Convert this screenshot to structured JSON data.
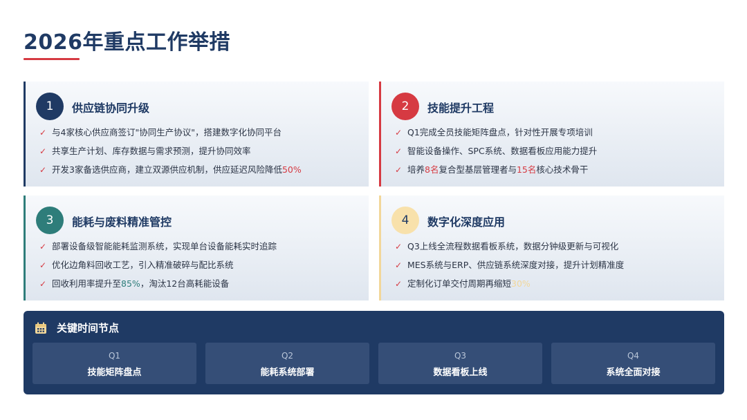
{
  "page": {
    "title": "2026年重点工作举措"
  },
  "colors": {
    "navy": "#1f3a64",
    "red": "#d63a42",
    "teal": "#2e7d7a",
    "gold": "#f2d79a"
  },
  "cards": [
    {
      "number": "1",
      "title": "供应链协同升级",
      "items": [
        {
          "text": "与4家核心供应商签订\"协同生产协议\"，搭建数字化协同平台"
        },
        {
          "text": "共享生产计划、库存数据与需求预测，提升协同效率"
        },
        {
          "pre": "开发3家备选供应商，建立双源供应机制，供应延迟风险降低",
          "hl": "50%"
        }
      ]
    },
    {
      "number": "2",
      "title": "技能提升工程",
      "items": [
        {
          "text": "Q1完成全员技能矩阵盘点，针对性开展专项培训"
        },
        {
          "text": "智能设备操作、SPC系统、数据看板应用能力提升"
        },
        {
          "pre": "培养",
          "hl1": "8名",
          "mid": "复合型基层管理者与",
          "hl2": "15名",
          "post": "核心技术骨干"
        }
      ]
    },
    {
      "number": "3",
      "title": "能耗与废料精准管控",
      "items": [
        {
          "text": "部署设备级智能能耗监测系统，实现单台设备能耗实时追踪"
        },
        {
          "text": "优化边角料回收工艺，引入精准破碎与配比系统"
        },
        {
          "pre": "回收利用率提升至",
          "hl": "85%",
          "post": "，淘汰12台高耗能设备"
        }
      ]
    },
    {
      "number": "4",
      "title": "数字化深度应用",
      "items": [
        {
          "text": "Q3上线全流程数据看板系统，数据分钟级更新与可视化"
        },
        {
          "text": "MES系统与ERP、供应链系统深度对接，提升计划精准度"
        },
        {
          "pre": "定制化订单交付周期再缩短",
          "hl": "30%"
        }
      ]
    }
  ],
  "timeline": {
    "title": "关键时间节点",
    "icon": "calendar-icon",
    "milestones": [
      {
        "quarter": "Q1",
        "label": "技能矩阵盘点"
      },
      {
        "quarter": "Q2",
        "label": "能耗系统部署"
      },
      {
        "quarter": "Q3",
        "label": "数据看板上线"
      },
      {
        "quarter": "Q4",
        "label": "系统全面对接"
      }
    ]
  }
}
